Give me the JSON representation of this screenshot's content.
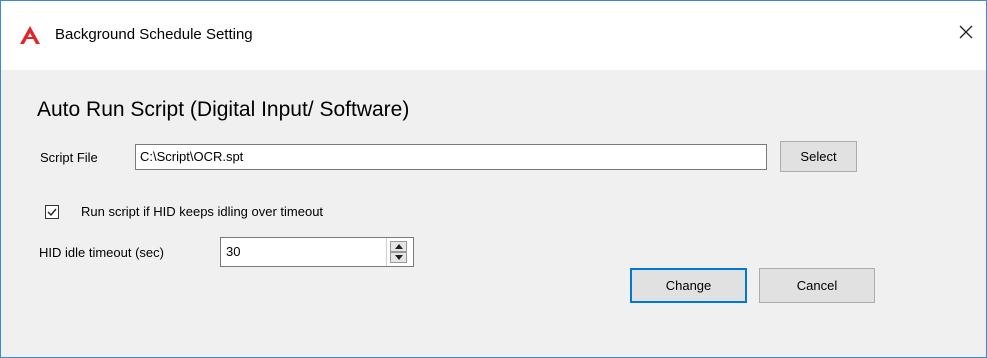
{
  "window": {
    "title": "Background Schedule Setting",
    "app_icon": "red-triangle-logo-icon",
    "close_icon": "close-icon",
    "accent_color": "#0078d7"
  },
  "section": {
    "heading": "Auto Run Script (Digital Input/ Software)"
  },
  "script_file": {
    "label": "Script File",
    "value": "C:\\Script\\OCR.spt",
    "select_label": "Select"
  },
  "idle_option": {
    "checked": true,
    "label": "Run script if HID keeps idling over timeout"
  },
  "timeout": {
    "label": "HID idle timeout (sec)",
    "value": "30"
  },
  "buttons": {
    "change": "Change",
    "cancel": "Cancel"
  }
}
